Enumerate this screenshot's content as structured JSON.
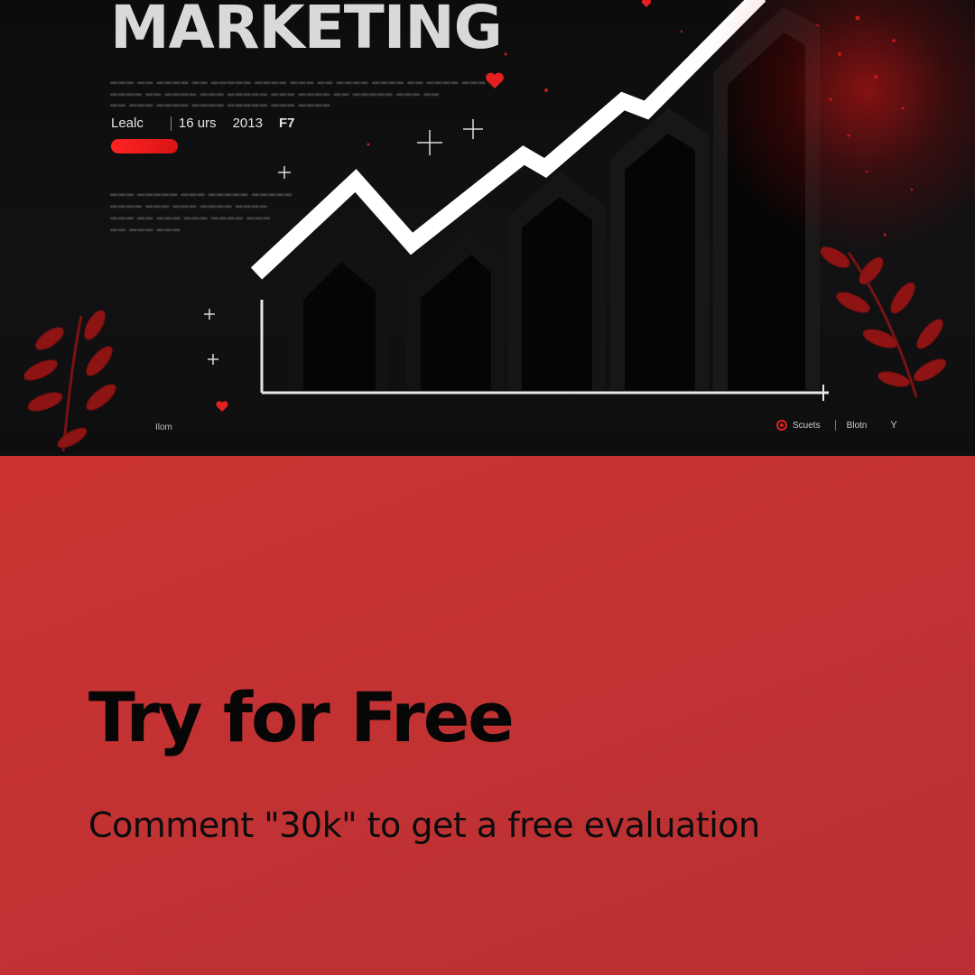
{
  "hero": {
    "title": "MARKETING",
    "meta": {
      "item1": "Lealc",
      "item2": "16 urs",
      "item3": "2013",
      "item4": "F7"
    },
    "bottom_left_label": "Ilom",
    "bottom_right": {
      "label1": "Scuets",
      "label2": "Blotn",
      "chevron": "Y"
    },
    "colors": {
      "accent": "#e32121",
      "background": "#0e0e0f",
      "line": "#ffffff"
    },
    "icons": [
      "heart-icon",
      "sparkle-icon",
      "leaf-branch-icon",
      "record-icon",
      "chevron-down-icon"
    ]
  },
  "cta": {
    "title": "Try for Free",
    "subtitle": "Comment \"30k\" to get a free evaluation",
    "colors": {
      "panel": "#c13233",
      "text": "#060606"
    }
  }
}
